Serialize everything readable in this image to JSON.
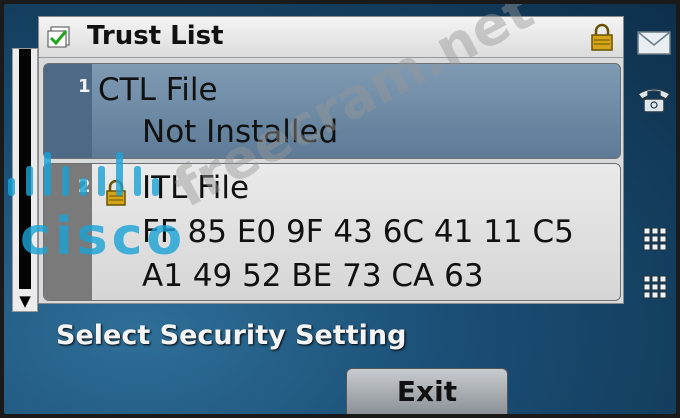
{
  "window": {
    "title": "Trust List"
  },
  "items": [
    {
      "number": "1",
      "name": "CTL File",
      "status": "Not Installed"
    },
    {
      "number": "2",
      "name": "ITL File",
      "hash_line1": "FF 85 E0 9F 43 6C 41 11 C5",
      "hash_line2": "A1 49 52 BE 73 CA 63"
    }
  ],
  "status": {
    "message": "Select Security Setting"
  },
  "softkeys": [
    {
      "label": "Exit"
    }
  ],
  "overlays": {
    "watermark": "freecram.net",
    "brand_logo": "cisco"
  },
  "icons": {
    "title": "checked-folder-icon",
    "title_lock": "lock-icon",
    "item2_lock": "lock-icon",
    "side": [
      "envelope-icon",
      "phone-icon",
      "keypad-icon",
      "keypad-icon"
    ]
  },
  "colors": {
    "selected_item": "#6f8ca8",
    "watermark": "#9a9a9a",
    "brand": "#1aa3d6"
  }
}
